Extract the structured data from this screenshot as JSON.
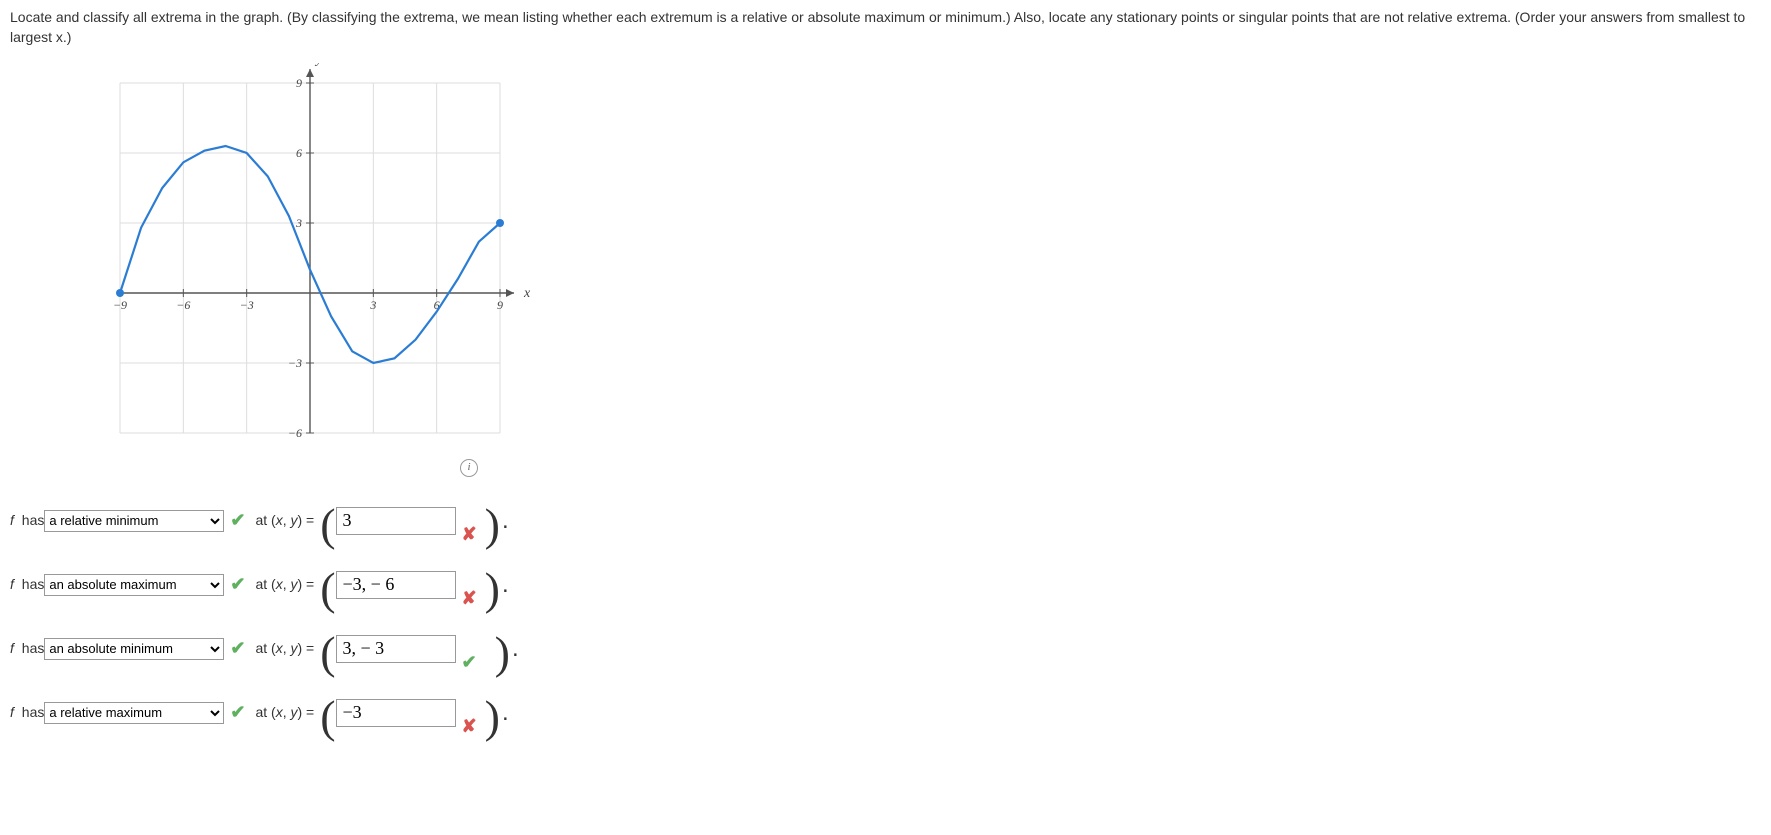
{
  "question": "Locate and classify all extrema in the graph. (By classifying the extrema, we mean listing whether each extremum is a relative or absolute maximum or minimum.) Also, locate any stationary points or singular points that are not relative extrema. (Order your answers from smallest to largest x.)",
  "chart_data": {
    "type": "line",
    "xlabel": "x",
    "ylabel": "y",
    "xlim": [
      -9,
      9
    ],
    "ylim": [
      -6,
      9
    ],
    "xticks": [
      -9,
      -6,
      -3,
      3,
      6,
      9
    ],
    "yticks": [
      -6,
      -3,
      3,
      6,
      9
    ],
    "series": [
      {
        "name": "f",
        "points": [
          {
            "x": -9,
            "y": 0,
            "endpoint": true
          },
          {
            "x": -8,
            "y": 2.8
          },
          {
            "x": -7,
            "y": 4.5
          },
          {
            "x": -6,
            "y": 5.6
          },
          {
            "x": -5,
            "y": 6.1
          },
          {
            "x": -4,
            "y": 6.3
          },
          {
            "x": -3,
            "y": 6
          },
          {
            "x": -2,
            "y": 5
          },
          {
            "x": -1,
            "y": 3.3
          },
          {
            "x": 0,
            "y": 1
          },
          {
            "x": 1,
            "y": -1
          },
          {
            "x": 2,
            "y": -2.5
          },
          {
            "x": 3,
            "y": -3
          },
          {
            "x": 4,
            "y": -2.8
          },
          {
            "x": 5,
            "y": -2
          },
          {
            "x": 6,
            "y": -0.8
          },
          {
            "x": 7,
            "y": 0.6
          },
          {
            "x": 8,
            "y": 2.2
          },
          {
            "x": 9,
            "y": 3,
            "endpoint": true
          }
        ]
      }
    ]
  },
  "dropdown_options": [
    "a relative minimum",
    "a relative maximum",
    "an absolute minimum",
    "an absolute maximum"
  ],
  "answers": [
    {
      "classification": "a relative minimum",
      "class_correct": true,
      "coord_value": "3",
      "coord_correct": false
    },
    {
      "classification": "an absolute maximum",
      "class_correct": true,
      "coord_value": "−3, − 6",
      "coord_correct": false
    },
    {
      "classification": "an absolute minimum",
      "class_correct": true,
      "coord_value": "3, − 3",
      "coord_correct": true
    },
    {
      "classification": "a relative maximum",
      "class_correct": true,
      "coord_value": "−3",
      "coord_correct": false
    }
  ],
  "labels": {
    "fhas_prefix": "f",
    "fhas_suffix": " has ",
    "at": "at (x, y) = ",
    "info": "i"
  }
}
